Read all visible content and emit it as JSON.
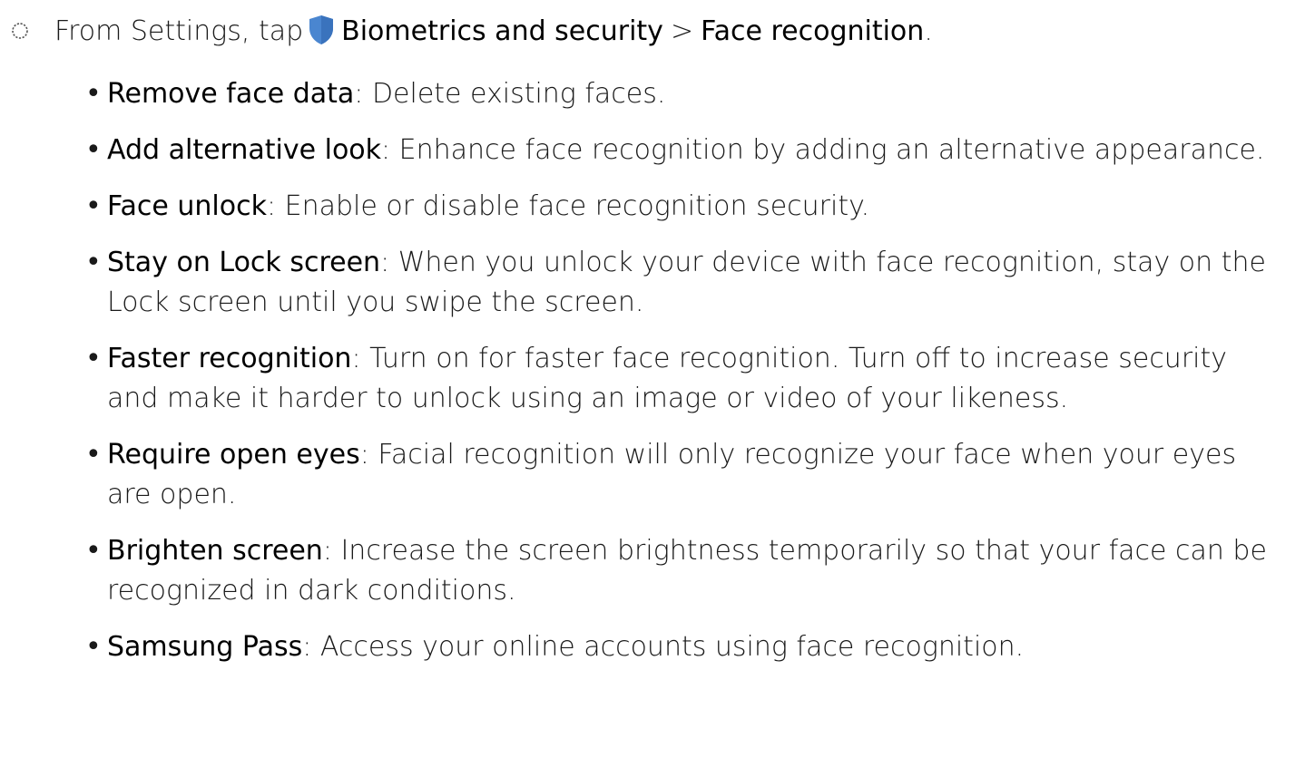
{
  "step": {
    "prefix": "From Settings, tap",
    "menu": "Biometrics and security",
    "separator": ">",
    "item": "Face recognition",
    "suffix": "."
  },
  "icons": {
    "step_marker": "step-circle-icon",
    "settings_icon": "shield-icon",
    "settings_icon_color": "#4a86d0"
  },
  "options": [
    {
      "bullet": "•",
      "name": "Remove face data",
      "description": ": Delete existing faces."
    },
    {
      "bullet": "•",
      "name": "Add alternative look",
      "description": ": Enhance face recognition by adding an alternative appearance."
    },
    {
      "bullet": "•",
      "name": "Face unlock",
      "description": ": Enable or disable face recognition security."
    },
    {
      "bullet": "•",
      "name": "Stay on Lock screen",
      "description": ": When you unlock your device with face recognition, stay on the Lock screen until you swipe the screen."
    },
    {
      "bullet": "•",
      "name": "Faster recognition",
      "description": ": Turn on for faster face recognition. Turn off to increase security and make it harder to unlock using an image or video of your likeness."
    },
    {
      "bullet": "•",
      "name": "Require open eyes",
      "description": ": Facial recognition will only recognize your face when your eyes are open."
    },
    {
      "bullet": "•",
      "name": "Brighten screen",
      "description": ": Increase the screen brightness temporarily so that your face can be recognized in dark conditions."
    },
    {
      "bullet": "•",
      "name": "Samsung Pass",
      "description": ": Access your online accounts using face recognition."
    }
  ]
}
